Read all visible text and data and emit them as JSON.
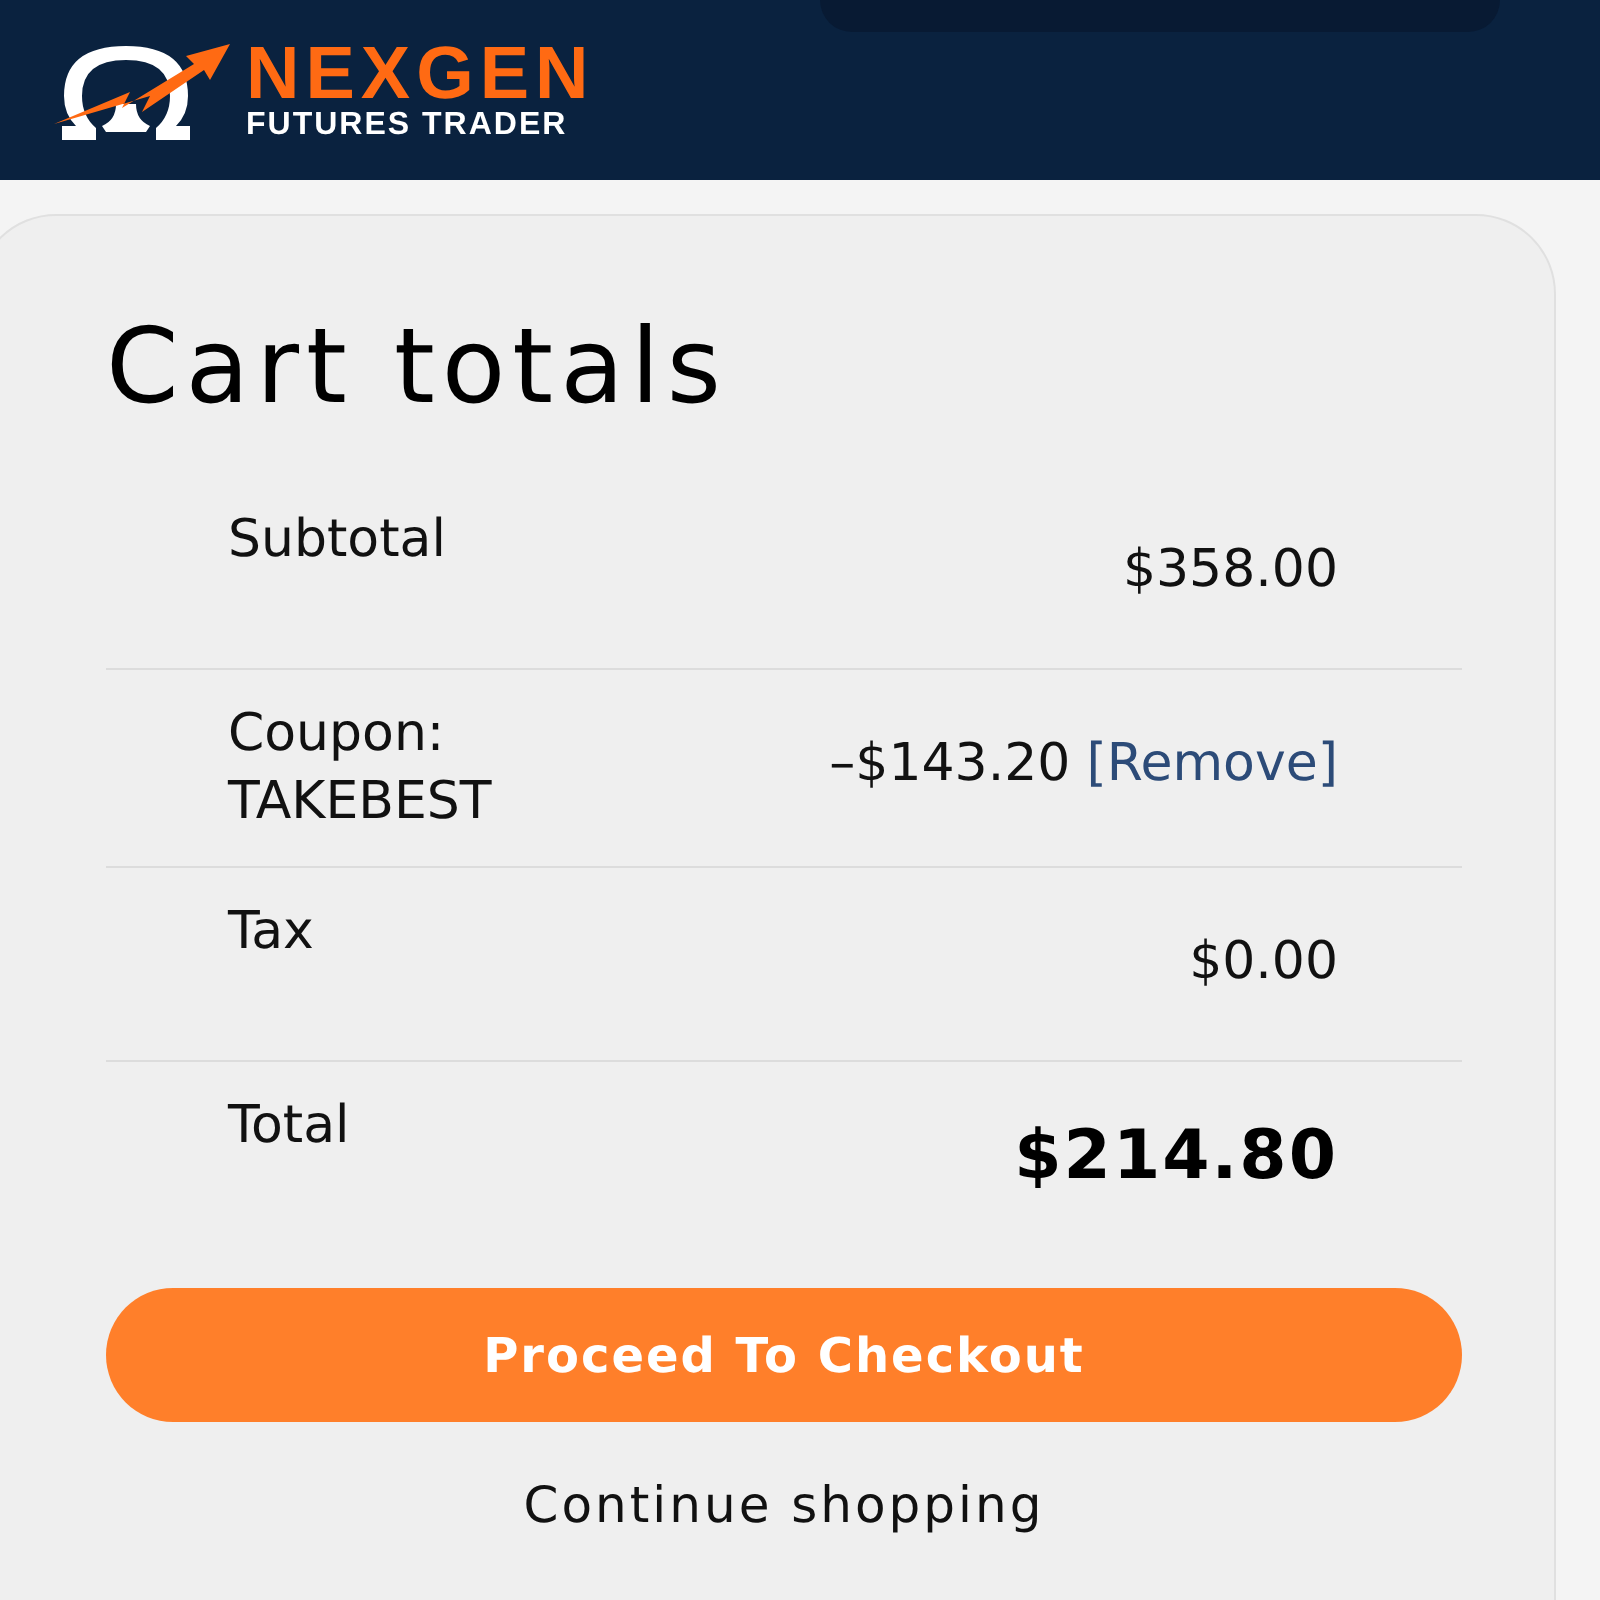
{
  "header": {
    "brand": {
      "name": "NEXGEN",
      "tagline": "FUTURES TRADER"
    }
  },
  "cart_totals": {
    "title": "Cart totals",
    "rows": [
      {
        "kind": "line",
        "label": "Subtotal",
        "value": "$358.00"
      },
      {
        "kind": "coupon",
        "label": "Coupon: TAKEBEST",
        "value": "–$143.20",
        "action": "[Remove]"
      },
      {
        "kind": "line",
        "label": "Tax",
        "value": "$0.00"
      },
      {
        "kind": "total",
        "label": "Total",
        "value": "$214.80"
      }
    ],
    "checkout_button": "Proceed To Checkout",
    "continue_link": "Continue shopping"
  }
}
